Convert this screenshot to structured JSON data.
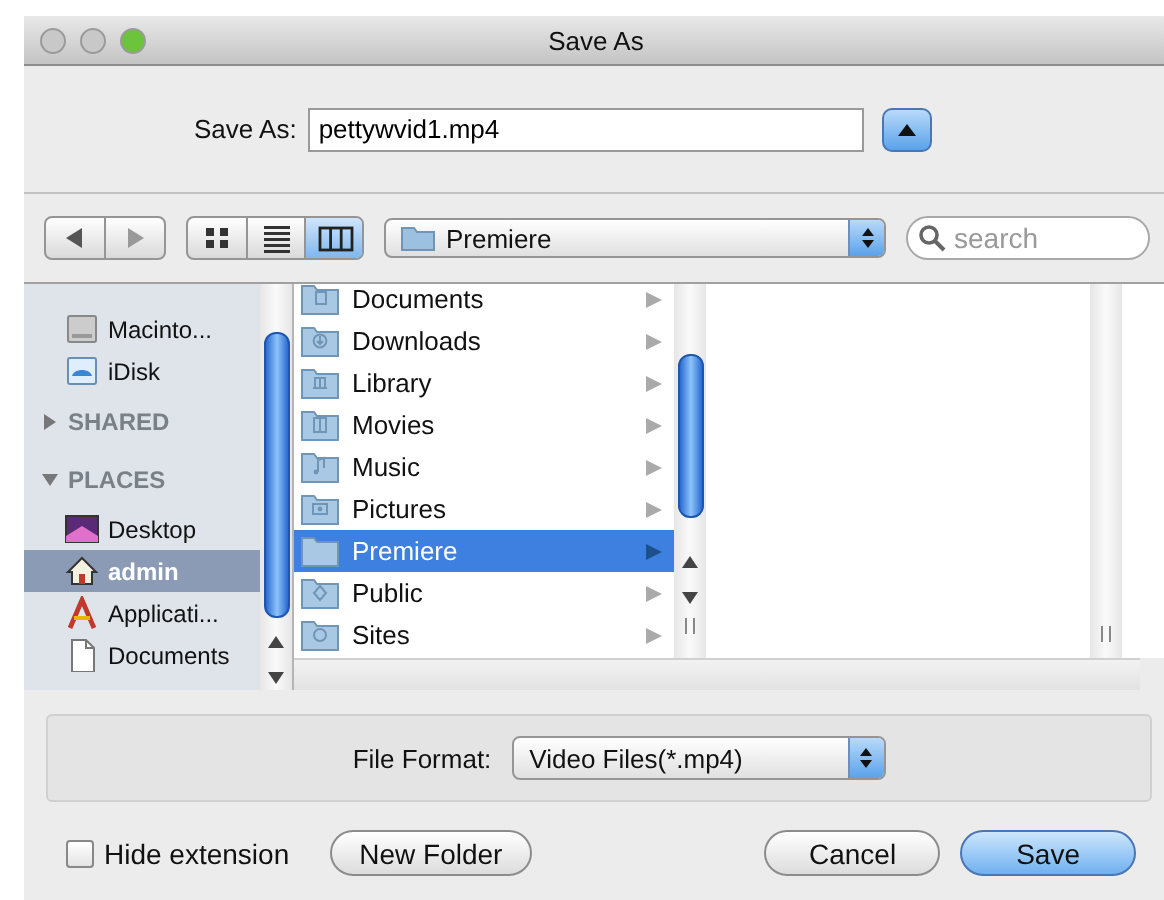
{
  "window": {
    "title": "Save As"
  },
  "save_as": {
    "label": "Save As:",
    "value": "pettywvid1.mp4"
  },
  "toolbar": {
    "view_modes": [
      {
        "kind": "icon",
        "selected": false
      },
      {
        "kind": "list",
        "selected": false
      },
      {
        "kind": "column",
        "selected": true
      }
    ],
    "location": "Premiere",
    "search": {
      "placeholder": "search"
    }
  },
  "sidebar": {
    "sections": [
      {
        "items": [
          {
            "label": "Macinto...",
            "kind": "drive",
            "selected": false
          },
          {
            "label": "iDisk",
            "kind": "idisk",
            "selected": false
          }
        ]
      },
      {
        "title": "SHARED",
        "expanded": false
      },
      {
        "title": "PLACES",
        "expanded": true,
        "items": [
          {
            "label": "Desktop",
            "kind": "desktop",
            "selected": false
          },
          {
            "label": "admin",
            "kind": "home",
            "selected": true
          },
          {
            "label": "Applicati...",
            "kind": "applications",
            "selected": false
          },
          {
            "label": "Documents",
            "kind": "document",
            "selected": false
          }
        ]
      }
    ]
  },
  "browser": {
    "columns": [
      {
        "items": [
          {
            "name": "Documents",
            "kind": "documents",
            "selected": false
          },
          {
            "name": "Downloads",
            "kind": "downloads",
            "selected": false
          },
          {
            "name": "Library",
            "kind": "library",
            "selected": false
          },
          {
            "name": "Movies",
            "kind": "movies",
            "selected": false
          },
          {
            "name": "Music",
            "kind": "music",
            "selected": false
          },
          {
            "name": "Pictures",
            "kind": "pictures",
            "selected": false
          },
          {
            "name": "Premiere",
            "kind": "plain",
            "selected": true
          },
          {
            "name": "Public",
            "kind": "public",
            "selected": false
          },
          {
            "name": "Sites",
            "kind": "sites",
            "selected": false
          }
        ]
      }
    ]
  },
  "file_format": {
    "label": "File Format:",
    "value": "Video Files(*.mp4)"
  },
  "hide_extension": {
    "label": "Hide extension",
    "checked": false
  },
  "buttons": [
    {
      "label": "New Folder",
      "kind": "normal"
    },
    {
      "label": "Cancel",
      "kind": "normal"
    },
    {
      "label": "Save",
      "kind": "default"
    }
  ]
}
